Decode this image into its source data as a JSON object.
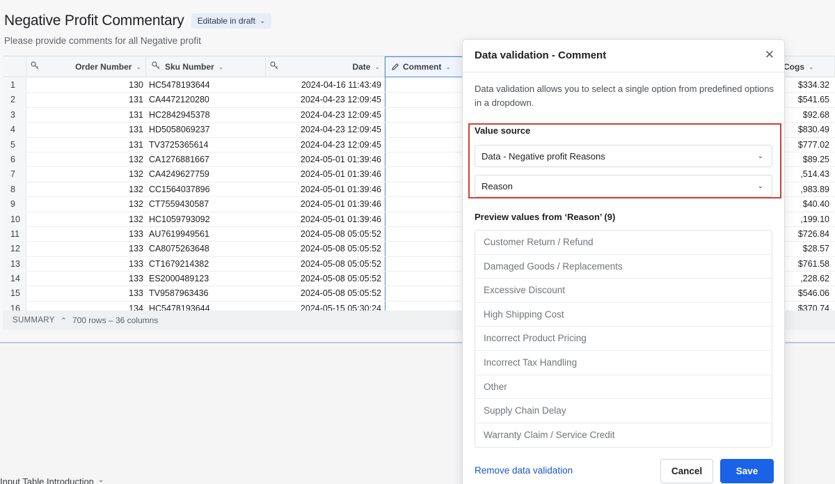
{
  "header": {
    "title": "Negative Profit Commentary",
    "badge": "Editable in draft",
    "subtitle": "Please provide comments for all Negative profit"
  },
  "table": {
    "columns": {
      "order": "Order Number",
      "sku": "Sku Number",
      "date": "Date",
      "comment": "Comment",
      "cogs": "Cogs"
    },
    "rows": [
      {
        "n": "1",
        "order": "130",
        "sku": "HC5478193644",
        "date": "2024-04-16 11:43:49",
        "cogs": "$334.32"
      },
      {
        "n": "2",
        "order": "131",
        "sku": "CA4472120280",
        "date": "2024-04-23 12:09:45",
        "cogs": "$541.65"
      },
      {
        "n": "3",
        "order": "131",
        "sku": "HC2842945378",
        "date": "2024-04-23 12:09:45",
        "cogs": "$92.68"
      },
      {
        "n": "4",
        "order": "131",
        "sku": "HD5058069237",
        "date": "2024-04-23 12:09:45",
        "cogs": "$830.49"
      },
      {
        "n": "5",
        "order": "131",
        "sku": "TV3725365614",
        "date": "2024-04-23 12:09:45",
        "cogs": "$777.02"
      },
      {
        "n": "6",
        "order": "132",
        "sku": "CA1276881667",
        "date": "2024-05-01 01:39:46",
        "cogs": "$89.25"
      },
      {
        "n": "7",
        "order": "132",
        "sku": "CA4249627759",
        "date": "2024-05-01 01:39:46",
        "cogs": ",514.43"
      },
      {
        "n": "8",
        "order": "132",
        "sku": "CC1564037896",
        "date": "2024-05-01 01:39:46",
        "cogs": ",983.89"
      },
      {
        "n": "9",
        "order": "132",
        "sku": "CT7559430587",
        "date": "2024-05-01 01:39:46",
        "cogs": "$40.40"
      },
      {
        "n": "10",
        "order": "132",
        "sku": "HC1059793092",
        "date": "2024-05-01 01:39:46",
        "cogs": ",199.10"
      },
      {
        "n": "11",
        "order": "133",
        "sku": "AU7619949561",
        "date": "2024-05-08 05:05:52",
        "cogs": "$726.84"
      },
      {
        "n": "12",
        "order": "133",
        "sku": "CA8075263648",
        "date": "2024-05-08 05:05:52",
        "cogs": "$28.57"
      },
      {
        "n": "13",
        "order": "133",
        "sku": "CT1679214382",
        "date": "2024-05-08 05:05:52",
        "cogs": "$761.58"
      },
      {
        "n": "14",
        "order": "133",
        "sku": "ES2000489123",
        "date": "2024-05-08 05:05:52",
        "cogs": ",228.62"
      },
      {
        "n": "15",
        "order": "133",
        "sku": "TV9587963436",
        "date": "2024-05-08 05:05:52",
        "cogs": "$546.06"
      },
      {
        "n": "16",
        "order": "134",
        "sku": "HC5478193644",
        "date": "2024-05-15 05:30:24",
        "cogs": "$370.74"
      }
    ]
  },
  "summary": {
    "label": "SUMMARY",
    "counts": "700 rows – 36 columns"
  },
  "bottom_tab": {
    "label": "Input Table Introduction"
  },
  "panel": {
    "title": "Data validation - Comment",
    "description": "Data validation allows you to select a single option from predefined options in a dropdown.",
    "value_source_label": "Value source",
    "source_value": "Data - Negative profit Reasons",
    "column_value": "Reason",
    "preview_label": "Preview values from ‘Reason’ (9)",
    "preview_values": [
      "Customer Return / Refund",
      "Damaged Goods / Replacements",
      "Excessive Discount",
      "High Shipping Cost",
      "Incorrect Product Pricing",
      "Incorrect Tax Handling",
      "Other",
      "Supply Chain Delay",
      "Warranty Claim / Service Credit"
    ],
    "remove_label": "Remove data validation",
    "cancel_label": "Cancel",
    "save_label": "Save"
  },
  "colors": {
    "accent": "#1a62e6",
    "highlight_border": "#d23f2e",
    "selected_column": "#4f86d9",
    "badge_bg": "#e6edf8"
  },
  "icons": [
    "key-icon",
    "pencil-icon",
    "chevron-down-icon",
    "close-icon",
    "caret-up-icon"
  ]
}
